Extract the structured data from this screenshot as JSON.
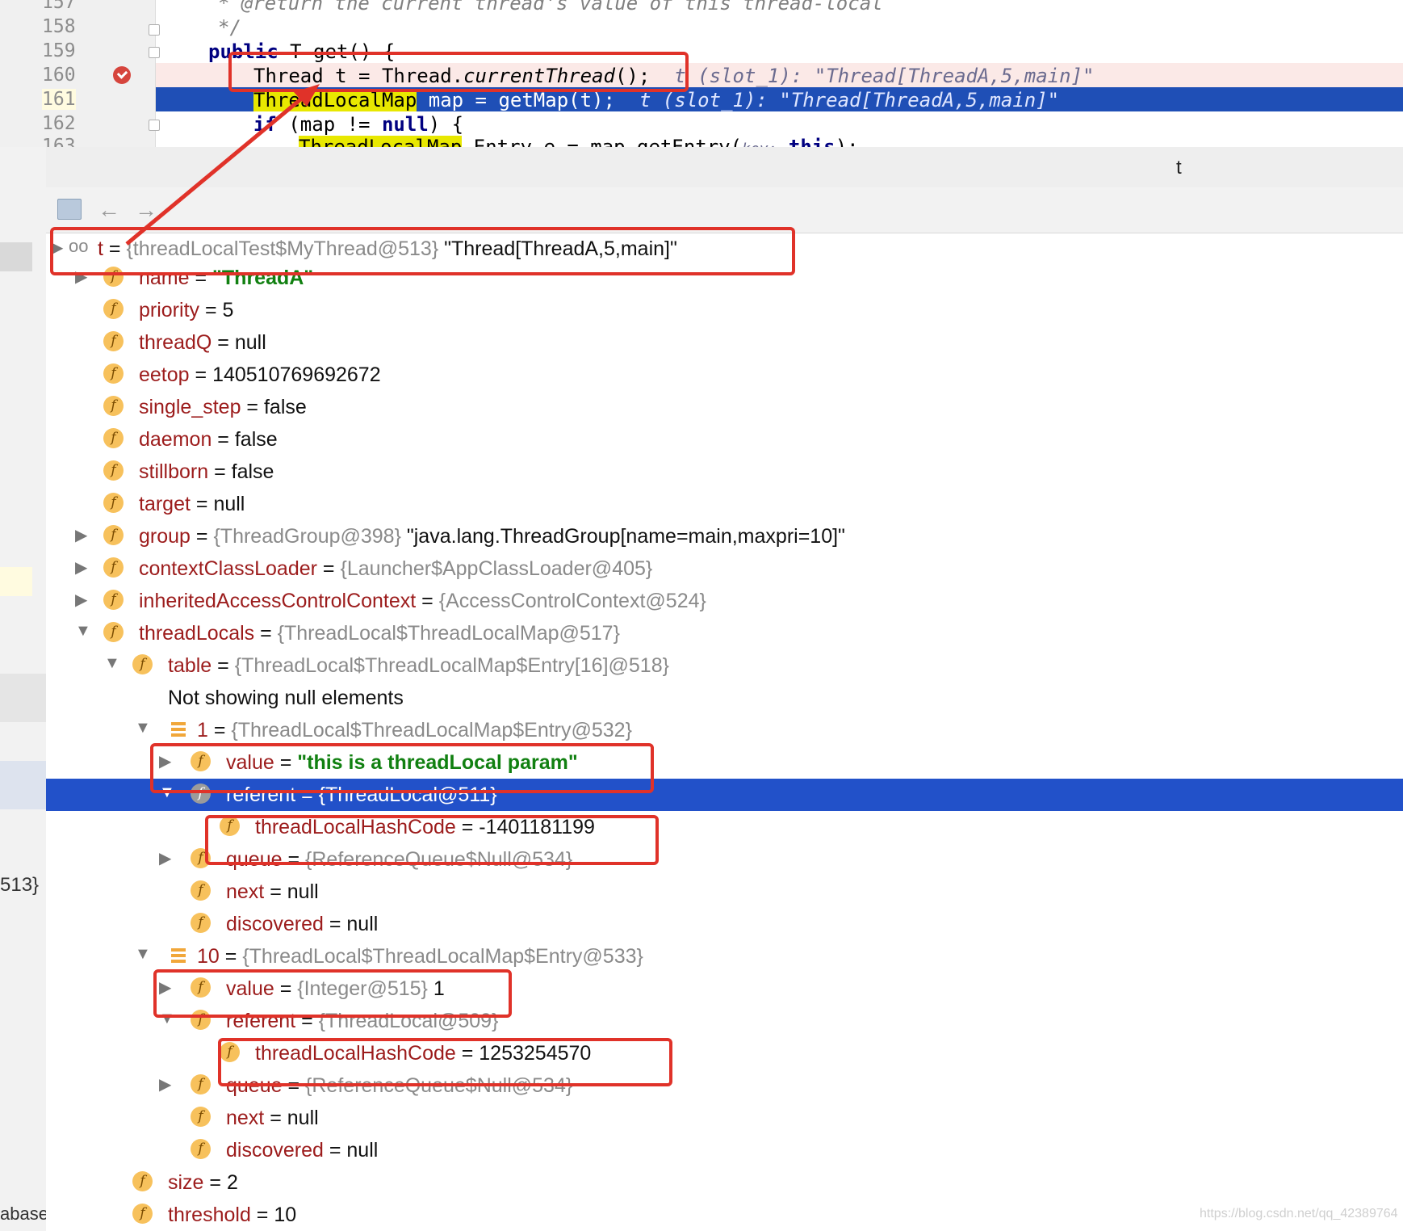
{
  "editor": {
    "lines": [
      {
        "num": "157",
        "text": "* @return the current thread's value of this thread-local"
      },
      {
        "num": "158",
        "text": "*/"
      },
      {
        "num": "159",
        "kw": "public",
        "rest": " T get() {"
      },
      {
        "num": "160",
        "code": "Thread t = Thread.",
        "call": "currentThread",
        "end": "();",
        "hint": "t (slot_1): \"Thread[ThreadA,5,main]\""
      },
      {
        "num": "161",
        "type": "ThreadLocalMap",
        "code": " map = getMap(t);",
        "hint": "t (slot_1): \"Thread[ThreadA,5,main]\""
      },
      {
        "num": "162",
        "kw": "if",
        "code": " (map != ",
        "kw2": "null",
        "end": ") {"
      },
      {
        "num": "163",
        "type": "ThreadLocalMap",
        "code": ".Entry e = map.getEntry(",
        "param": "key:",
        "kw": "this",
        "end": ");"
      }
    ]
  },
  "popup": {
    "title": "t"
  },
  "toolbar": {
    "icons": [
      "frame-icon",
      "back-arrow-icon",
      "forward-arrow-icon"
    ]
  },
  "tree": {
    "root": {
      "name": "t",
      "eq": " = ",
      "type": "{threadLocalTest$MyThread@513}",
      "value": " \"Thread[ThreadA,5,main]\""
    },
    "rows": [
      {
        "name": "name",
        "value": "\"ThreadA\"",
        "str": true
      },
      {
        "name": "priority",
        "value": "5"
      },
      {
        "name": "threadQ",
        "value": "null"
      },
      {
        "name": "eetop",
        "value": "140510769692672"
      },
      {
        "name": "single_step",
        "value": "false"
      },
      {
        "name": "daemon",
        "value": "false"
      },
      {
        "name": "stillborn",
        "value": "false"
      },
      {
        "name": "target",
        "value": "null"
      },
      {
        "name": "group",
        "type": "{ThreadGroup@398}",
        "value": " \"java.lang.ThreadGroup[name=main,maxpri=10]\""
      },
      {
        "name": "contextClassLoader",
        "type": "{Launcher$AppClassLoader@405}"
      },
      {
        "name": "inheritedAccessControlContext",
        "type": "{AccessControlContext@524}"
      },
      {
        "name": "threadLocals",
        "type": "{ThreadLocal$ThreadLocalMap@517}"
      },
      {
        "name": "table",
        "type": "{ThreadLocal$ThreadLocalMap$Entry[16]@518}"
      },
      {
        "text": "Not showing null elements"
      },
      {
        "name": "1",
        "type": "{ThreadLocal$ThreadLocalMap$Entry@532}"
      },
      {
        "name": "value",
        "value": "\"this is a threadLocal param\"",
        "str": true
      },
      {
        "name": "referent",
        "type": "{ThreadLocal@511}"
      },
      {
        "name": "threadLocalHashCode",
        "value": "-1401181199"
      },
      {
        "name": "queue",
        "type": "{ReferenceQueue$Null@534}"
      },
      {
        "name": "next",
        "value": "null"
      },
      {
        "name": "discovered",
        "value": "null"
      },
      {
        "name": "10",
        "type": "{ThreadLocal$ThreadLocalMap$Entry@533}"
      },
      {
        "name": "value",
        "type": "{Integer@515}",
        "value": " 1"
      },
      {
        "name": "referent",
        "type": "{ThreadLocal@509}"
      },
      {
        "name": "threadLocalHashCode",
        "value": "1253254570"
      },
      {
        "name": "queue",
        "type": "{ReferenceQueue$Null@534}"
      },
      {
        "name": "next",
        "value": "null"
      },
      {
        "name": "discovered",
        "value": "null"
      },
      {
        "name": "size",
        "value": "2"
      },
      {
        "name": "threshold",
        "value": "10"
      }
    ]
  },
  "left_fragments": {
    "a": "513}",
    "b": "abase"
  },
  "watermark": "https://blog.csdn.net/qq_42389764",
  "colors": {
    "selection": "#2251c9",
    "annotation": "#e03229",
    "field_icon": "#f7c15c",
    "string_value": "#118011"
  }
}
